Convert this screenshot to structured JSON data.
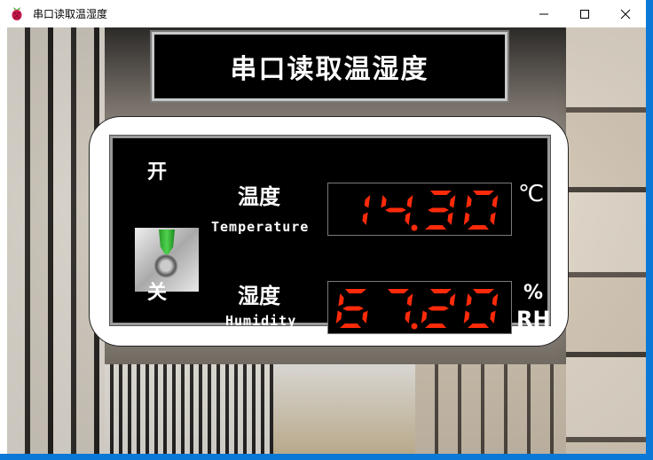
{
  "window": {
    "title": "串口读取温湿度",
    "app_icon": "raspberry-pi-icon",
    "controls": {
      "minimize": "minimize-icon",
      "maximize": "maximize-icon",
      "close": "close-icon"
    }
  },
  "header": {
    "title": "串口读取温湿度"
  },
  "switch": {
    "on_label": "开",
    "off_label": "关",
    "state": "on"
  },
  "temperature": {
    "label_cn": "温度",
    "label_en": "Temperature",
    "value": "14.30",
    "unit": "℃"
  },
  "humidity": {
    "label_cn": "湿度",
    "label_en": "Humidity",
    "value": "67.20",
    "unit_top": "%",
    "unit_bottom": "RH"
  },
  "colors": {
    "segment": "#ff2a0a",
    "board": "#000000",
    "accent_switch": "#3cc43c"
  }
}
